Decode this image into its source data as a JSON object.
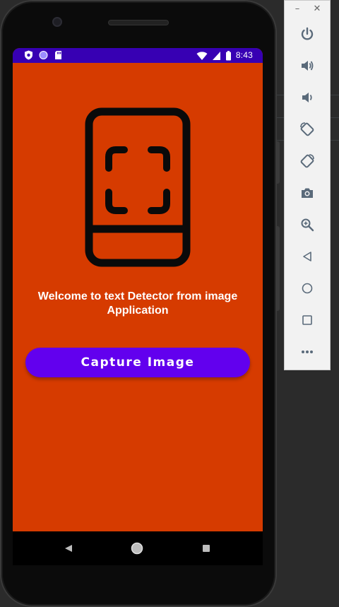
{
  "app": {
    "welcome_text": "Welcome to text Detector from image Application",
    "capture_button_label": "Capture Image"
  },
  "status_bar": {
    "time": "8:43",
    "icons_left": [
      "shield-icon",
      "circle-icon",
      "sd-card-icon"
    ],
    "icons_right": [
      "wifi-icon",
      "signal-icon",
      "battery-icon"
    ]
  },
  "nav_bar": {
    "buttons": [
      "back-icon",
      "home-icon",
      "recents-icon"
    ]
  },
  "toolbar": {
    "minimize_label": "–",
    "close_label": "✕",
    "buttons": [
      "power-icon",
      "volume-up-icon",
      "volume-down-icon",
      "rotate-left-icon",
      "rotate-right-icon",
      "camera-icon",
      "zoom-icon",
      "back-icon",
      "home-icon",
      "overview-icon",
      "more-icon"
    ]
  },
  "colors": {
    "screen_background": "#d63b00",
    "status_bar": "#3700b3",
    "button": "#6200ee",
    "text": "#ffffff"
  }
}
